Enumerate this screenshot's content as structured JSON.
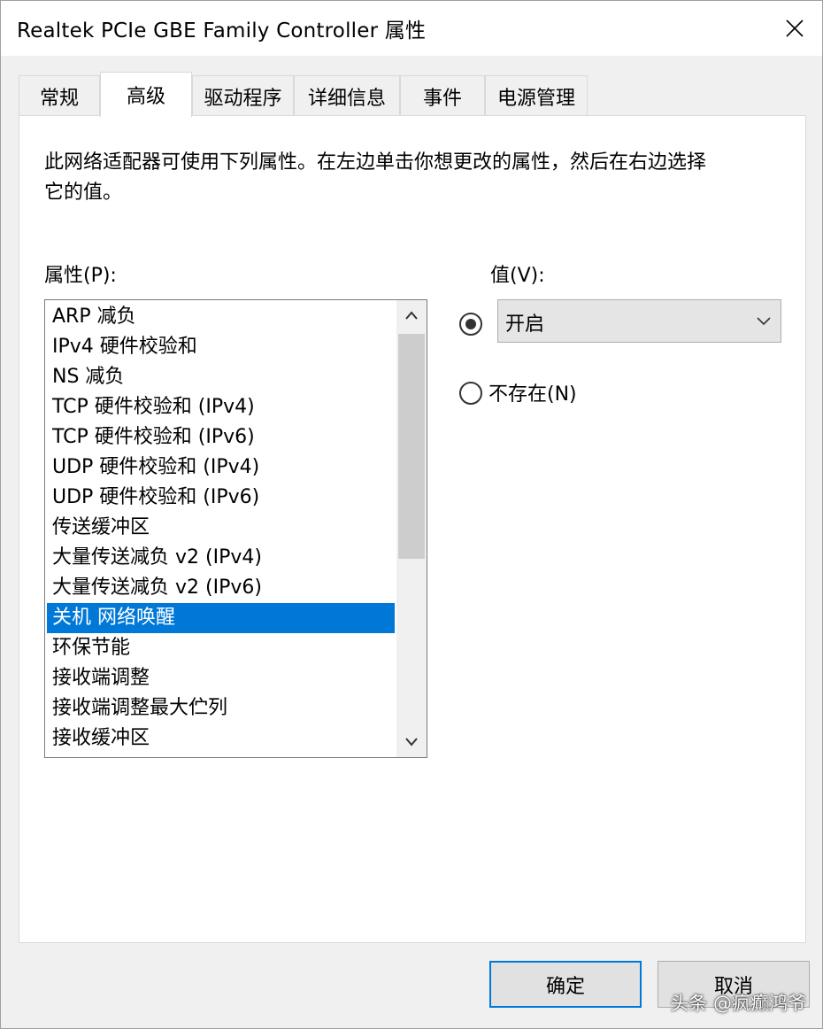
{
  "window": {
    "title": "Realtek PCIe GBE Family Controller 属性"
  },
  "tabs": [
    {
      "label": "常规",
      "active": false
    },
    {
      "label": "高级",
      "active": true
    },
    {
      "label": "驱动程序",
      "active": false
    },
    {
      "label": "详细信息",
      "active": false
    },
    {
      "label": "事件",
      "active": false
    },
    {
      "label": "电源管理",
      "active": false
    }
  ],
  "advanced": {
    "description": "此网络适配器可使用下列属性。在左边单击你想更改的属性，然后在右边选择它的值。",
    "property_label": "属性(P):",
    "value_label": "值(V):",
    "properties": [
      "ARP 减负",
      "IPv4 硬件校验和",
      "NS 减负",
      "TCP 硬件校验和 (IPv4)",
      "TCP 硬件校验和 (IPv6)",
      "UDP 硬件校验和 (IPv4)",
      "UDP 硬件校验和 (IPv6)",
      "传送缓冲区",
      "大量传送减负 v2 (IPv4)",
      "大量传送减负 v2 (IPv6)",
      "关机 网络唤醒",
      "环保节能",
      "接收端调整",
      "接收端调整最大伫列",
      "接收缓冲区"
    ],
    "selected_property": "关机 网络唤醒",
    "value_selected": "开启",
    "value_radio_checked": true,
    "absent_label": "不存在(N)",
    "absent_radio_checked": false
  },
  "buttons": {
    "ok": "确定",
    "cancel": "取消"
  },
  "watermark": "头条 @疯癫鸿爷",
  "colors": {
    "selection": "#0078d7",
    "default_button_border": "#0078d7"
  },
  "icons": {
    "close": "close-icon",
    "scroll_up": "chevron-up-icon",
    "scroll_down": "chevron-down-icon",
    "dropdown": "chevron-down-icon"
  }
}
